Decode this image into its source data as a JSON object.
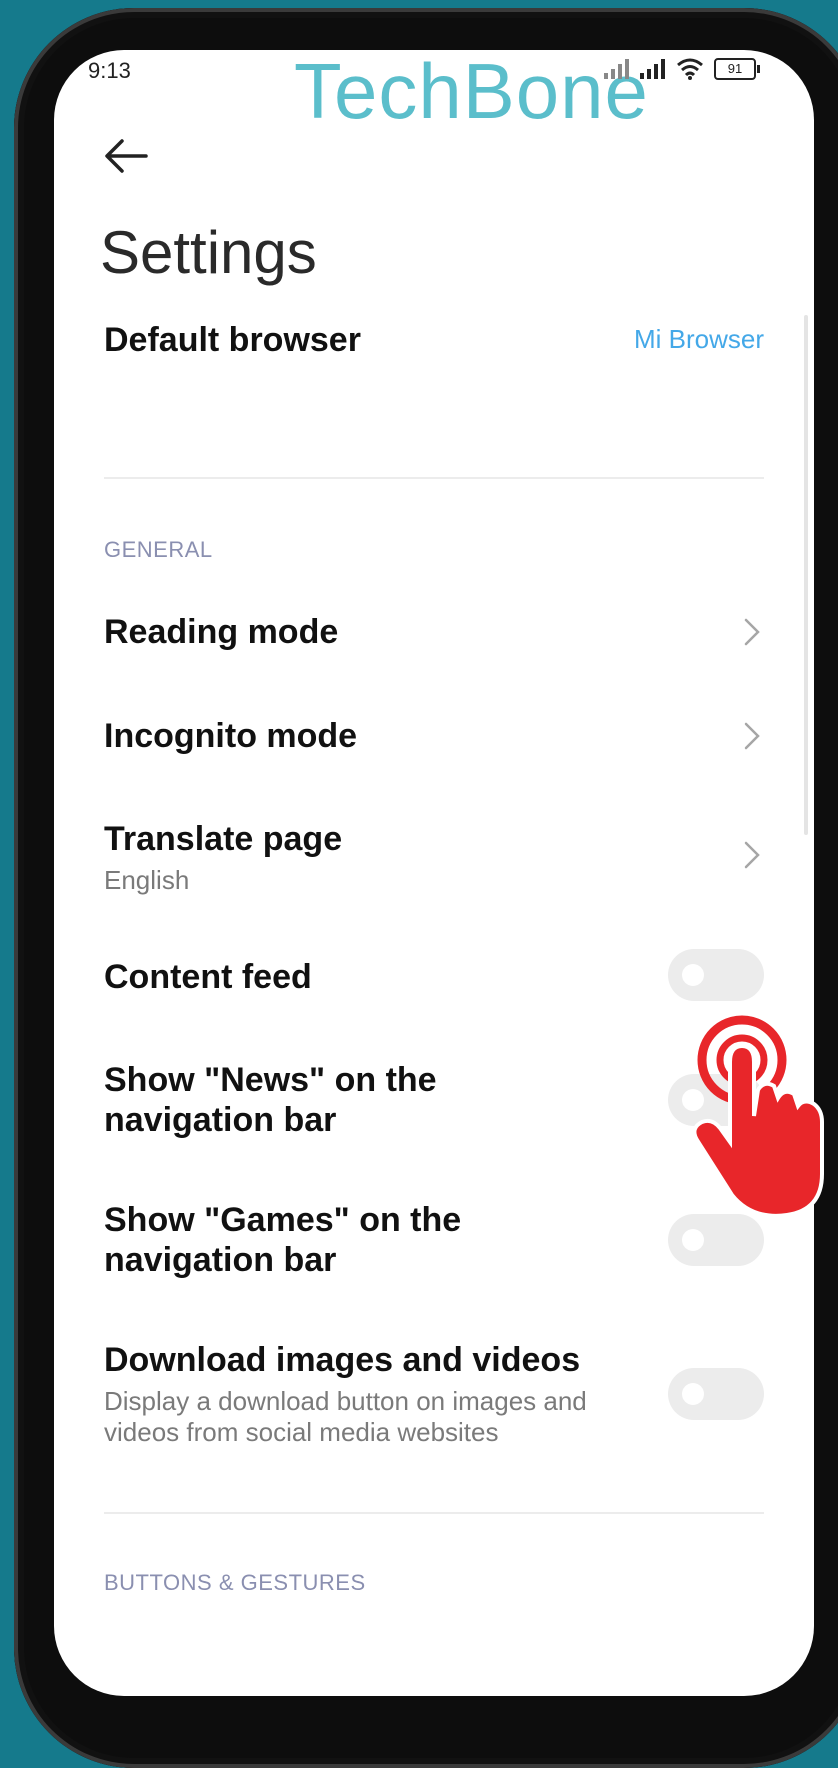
{
  "status_bar": {
    "time": "9:13",
    "battery": "91"
  },
  "watermark": "TechBone",
  "header": {
    "title": "Settings"
  },
  "default_browser": {
    "label": "Default browser",
    "value": "Mi Browser"
  },
  "sections": {
    "general": "GENERAL",
    "buttons_gestures": "BUTTONS & GESTURES"
  },
  "items": {
    "reading_mode": {
      "label": "Reading mode"
    },
    "incognito_mode": {
      "label": "Incognito mode"
    },
    "translate_page": {
      "label": "Translate page",
      "sub": "English"
    },
    "content_feed": {
      "label": "Content feed",
      "state": "off"
    },
    "show_news": {
      "label": "Show \"News\" on the navigation bar",
      "state": "off"
    },
    "show_games": {
      "label": "Show \"Games\" on the navigation bar",
      "state": "off"
    },
    "download_media": {
      "label": "Download images and videos",
      "sub": "Display a download button on images and videos from social media websites",
      "state": "off"
    }
  },
  "colors": {
    "accent": "#44a8e8",
    "watermark": "#5bbecb",
    "tap_indicator": "#e8262a",
    "background": "#157a8c"
  },
  "icons": {
    "back": "arrow-left-icon",
    "chevron": "chevron-right-icon",
    "tap": "hand-tap-icon"
  }
}
